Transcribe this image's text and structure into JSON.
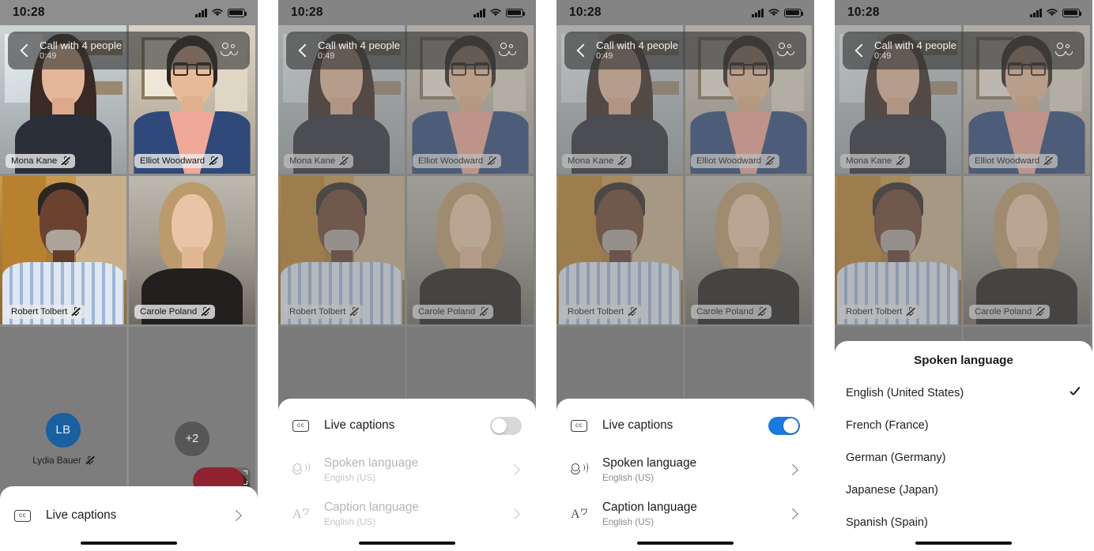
{
  "status_bar": {
    "time": "10:28",
    "signal_icon": "cellular-bars-icon",
    "wifi_icon": "wifi-icon",
    "battery_icon": "battery-full-icon"
  },
  "call_header": {
    "back_icon": "back-chevron-icon",
    "title": "Call with 4 people",
    "duration": "0:49",
    "participants_icon": "people-icon"
  },
  "participants": [
    {
      "name": "Mona Kane",
      "muted": true
    },
    {
      "name": "Elliot Woodward",
      "muted": true
    },
    {
      "name": "Robert Tolbert",
      "muted": true
    },
    {
      "name": "Carole Poland",
      "muted": true
    },
    {
      "name": "Lydia Bauer",
      "muted": true,
      "initials": "LB",
      "avatar_color": "#1a5fa0"
    }
  ],
  "overflow_badge": "+2",
  "self_view": {
    "flip_camera_icon": "flip-camera-icon"
  },
  "panel1": {
    "sheet": {
      "row": {
        "icon": "cc-icon",
        "label": "Live captions",
        "chevron_icon": "chevron-right-icon"
      }
    }
  },
  "captions_sheet": {
    "live_captions": {
      "icon": "cc-icon",
      "label": "Live captions",
      "toggle_off": "off",
      "toggle_on": "on"
    },
    "spoken_language": {
      "icon": "speaker-icon",
      "label": "Spoken language",
      "value": "English (US)",
      "chevron_icon": "chevron-right-icon"
    },
    "caption_language": {
      "icon": "translate-icon",
      "label": "Caption language",
      "value": "English (US)",
      "chevron_icon": "chevron-right-icon"
    }
  },
  "language_sheet": {
    "title": "Spoken language",
    "options": [
      {
        "label": "English (United States)",
        "selected": true
      },
      {
        "label": "French (France)",
        "selected": false
      },
      {
        "label": "German (Germany)",
        "selected": false
      },
      {
        "label": "Japanese (Japan)",
        "selected": false
      },
      {
        "label": "Spanish (Spain)",
        "selected": false
      }
    ],
    "check_icon": "check-icon"
  },
  "colors": {
    "accent_blue": "#1b7ae0",
    "toggle_off": "#d8d8d8",
    "end_call_red": "#8f2230",
    "avatar_blue": "#1a5fa0"
  }
}
